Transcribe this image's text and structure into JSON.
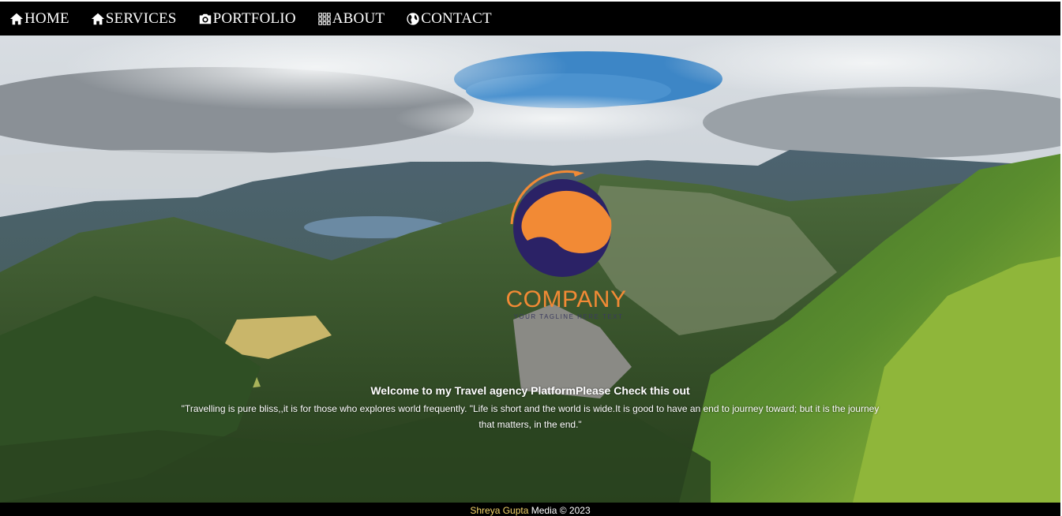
{
  "nav": {
    "items": [
      {
        "label": "HOME",
        "icon": "home-icon"
      },
      {
        "label": "SERVICES",
        "icon": "home-icon"
      },
      {
        "label": "PORTFOLIO",
        "icon": "camera-icon"
      },
      {
        "label": "ABOUT",
        "icon": "grid-icon"
      },
      {
        "label": "CONTACT",
        "icon": "globe-icon"
      }
    ]
  },
  "logo": {
    "name": "COMPANY",
    "tagline": "YOUR TAGLINE HERE TEXT"
  },
  "hero": {
    "welcome": "Welcome to my  Travel agency PlatformPlease Check this out",
    "quote": "\"Travelling is pure bliss,,it is for those who explores world frequently. \"Life is short and the world is wide.It is good to have an end to journey toward; but it is the journey that matters, in the end.\""
  },
  "footer": {
    "name": "Shreya Gupta",
    "suffix": " Media © 2023"
  },
  "colors": {
    "nav_bg": "#000000",
    "logo_orange": "#f28a35",
    "logo_navy": "#2b2266",
    "footer_name": "#f5d56b"
  }
}
